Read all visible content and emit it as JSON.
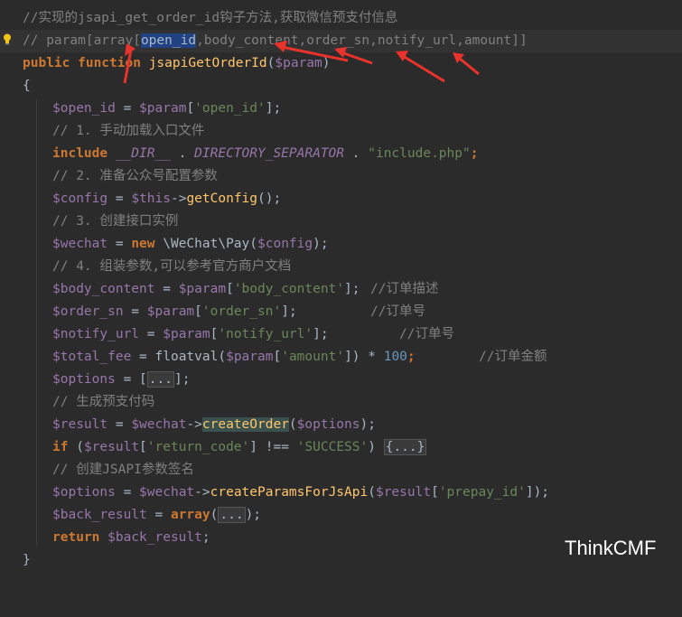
{
  "lines": {
    "l1": "//实现的jsapi_get_order_id钩子方法,获取微信预支付信息",
    "l2_prefix": "// param[array[",
    "l2_selected": "open_id",
    "l2_rest": ",body_content,order_sn,notify_url,amount]]",
    "l3_kw": "public function ",
    "l3_fn": "jsapiGetOrderId",
    "l3_open": "(",
    "l3_var": "$param",
    "l3_close": ")",
    "l4": "{",
    "l5_var": "$open_id",
    "l5_op": " = ",
    "l5_var2": "$param",
    "l5_b1": "[",
    "l5_str": "'open_id'",
    "l5_b2": "];",
    "l6": "// 1. 手动加载入口文件",
    "l7_kw": "include ",
    "l7_const": "__DIR__",
    "l7_dot1": " . ",
    "l7_const2": "DIRECTORY_SEPARATOR",
    "l7_dot2": " . ",
    "l7_str": "\"include.php\"",
    "l7_end": ";",
    "l8": "// 2. 准备公众号配置参数",
    "l9_var": "$config",
    "l9_op": " = ",
    "l9_this": "$this",
    "l9_arrow": "->",
    "l9_fn": "getConfig",
    "l9_end": "();",
    "l10": "// 3. 创建接口实例",
    "l11_var": "$wechat",
    "l11_op": " = ",
    "l11_kw": "new ",
    "l11_cls": "\\WeChat\\Pay",
    "l11_open": "(",
    "l11_arg": "$config",
    "l11_end": ");",
    "l12": "// 4. 组装参数,可以参考官方商户文档",
    "l13_var": "$body_content",
    "l13_op": " = ",
    "l13_var2": "$param",
    "l13_b1": "[",
    "l13_str": "'body_content'",
    "l13_b2": "];",
    "l13_cmt": "//订单描述",
    "l14_var": "$order_sn",
    "l14_op": " = ",
    "l14_var2": "$param",
    "l14_b1": "[",
    "l14_str": "'order_sn'",
    "l14_b2": "];",
    "l14_cmt": "//订单号",
    "l15_var": "$notify_url",
    "l15_op": " = ",
    "l15_var2": "$param",
    "l15_b1": "[",
    "l15_str": "'notify_url'",
    "l15_b2": "];",
    "l15_cmt": "//订单号",
    "l16_var": "$total_fee",
    "l16_op": " = ",
    "l16_fn": "floatval",
    "l16_open": "(",
    "l16_var2": "$param",
    "l16_b1": "[",
    "l16_str": "'amount'",
    "l16_b2": "]) * ",
    "l16_num": "100",
    "l16_end": ";",
    "l16_cmt": "//订单金额",
    "l17_var": "$options",
    "l17_op": " = [",
    "l17_fold": "...",
    "l17_end": "];",
    "l18": "// 生成预支付码",
    "l19_var": "$result",
    "l19_op": " = ",
    "l19_var2": "$wechat",
    "l19_arrow": "->",
    "l19_fn": "createOrder",
    "l19_open": "(",
    "l19_arg": "$options",
    "l19_end": ");",
    "l20_kw": "if ",
    "l20_open": "(",
    "l20_var": "$result",
    "l20_b1": "[",
    "l20_str": "'return_code'",
    "l20_op": "] !== ",
    "l20_str2": "'SUCCESS'",
    "l20_close": ") ",
    "l20_fold": "{...}",
    "l21": "// 创建JSAPI参数签名",
    "l22_var": "$options",
    "l22_op": " = ",
    "l22_var2": "$wechat",
    "l22_arrow": "->",
    "l22_fn": "createParamsForJsApi",
    "l22_open": "(",
    "l22_var3": "$result",
    "l22_b1": "[",
    "l22_str": "'prepay_id'",
    "l22_end": "]);",
    "l23_var": "$back_result",
    "l23_op": " = ",
    "l23_kw": "array",
    "l23_open": "(",
    "l23_fold": "...",
    "l23_end": ");",
    "l24_kw": "return ",
    "l24_var": "$back_result",
    "l24_end": ";",
    "l25": "}"
  },
  "watermark": "ThinkCMF",
  "colors": {
    "background": "#2b2b2b",
    "comment": "#808080",
    "variable": "#9876aa",
    "keyword": "#cc7832",
    "string": "#6a8759",
    "function": "#ffc66d",
    "number": "#6897bb",
    "arrow": "#e8322c"
  },
  "icons": [
    "lightbulb-icon",
    "annotation-arrow"
  ]
}
